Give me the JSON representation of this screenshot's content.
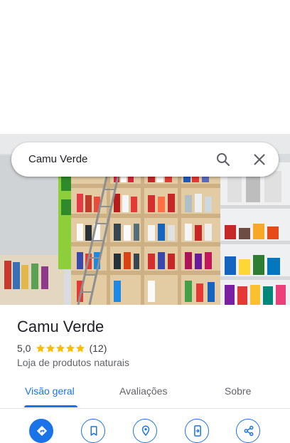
{
  "search": {
    "query": "Camu Verde"
  },
  "place": {
    "name": "Camu Verde",
    "rating": "5,0",
    "stars": 5,
    "reviews_count": "(12)",
    "category": "Loja de produtos naturais"
  },
  "tabs": [
    "Visão geral",
    "Avaliações",
    "Sobre"
  ],
  "colors": {
    "accent": "#1a73e8",
    "star": "#fbbc04",
    "text": "#202124",
    "secondary": "#5f6368"
  },
  "actions": [
    "directions-icon",
    "save-icon",
    "nearby-icon",
    "send-to-phone-icon",
    "share-icon"
  ]
}
